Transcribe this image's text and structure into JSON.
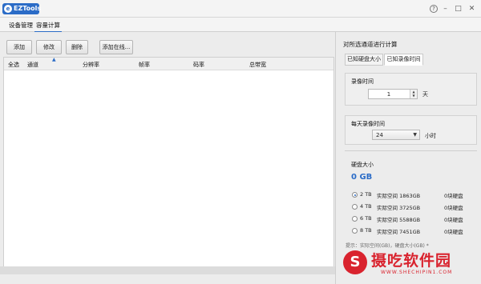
{
  "app": {
    "title": "EZTools",
    "logo_letter": "e"
  },
  "window_controls": {
    "help": "?",
    "minimize": "–",
    "maximize": "□",
    "close": "✕"
  },
  "tabs": [
    {
      "label": "设备管理"
    },
    {
      "label": "容量计算"
    }
  ],
  "toolbar": {
    "add": "添加",
    "edit": "修改",
    "delete": "删除",
    "add_online": "添加在线..."
  },
  "table": {
    "columns": [
      "全选",
      "通道",
      "分辨率",
      "帧率",
      "码率",
      "总带宽"
    ],
    "rows": []
  },
  "panel": {
    "title": "对所选通道进行计算",
    "subtabs": [
      "已知硬盘大小",
      "已知录像时间"
    ],
    "record_days": {
      "label": "录像时间",
      "value": "1",
      "unit": "天"
    },
    "daily_hours": {
      "label": "每天录像时间",
      "value": "24",
      "unit": "小时"
    },
    "disk": {
      "label": "硬盘大小",
      "total": "0 GB",
      "options": [
        {
          "size": "2 TB",
          "real": "实际空间 1863GB",
          "count": "0块硬盘",
          "selected": true
        },
        {
          "size": "4 TB",
          "real": "实际空间 3725GB",
          "count": "0块硬盘",
          "selected": false
        },
        {
          "size": "6 TB",
          "real": "实际空间 5588GB",
          "count": "0块硬盘",
          "selected": false
        },
        {
          "size": "8 TB",
          "real": "实际空间 7451GB",
          "count": "0块硬盘",
          "selected": false
        }
      ]
    },
    "hint": "提示：实际空间(GB)，硬盘大小(GB) *"
  },
  "watermark": {
    "letter": "S",
    "text": "摄吃软件园",
    "url": "WWW.SHECHIPIN1.COM"
  },
  "colors": {
    "accent": "#2b6cc7",
    "watermark": "#d9232e"
  }
}
